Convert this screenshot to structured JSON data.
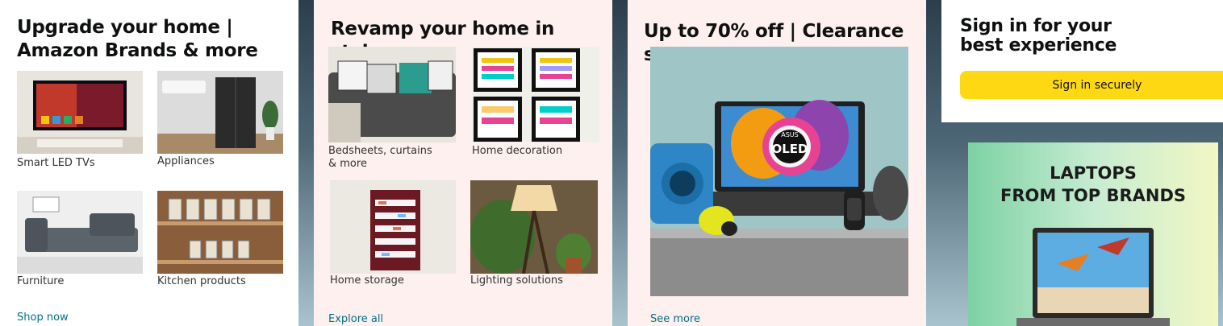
{
  "card_upgrade": {
    "title": "Upgrade your home | Amazon Brands & more",
    "tiles": [
      {
        "label": "Smart LED TVs"
      },
      {
        "label": "Appliances"
      },
      {
        "label": "Furniture"
      },
      {
        "label": "Kitchen products"
      }
    ],
    "link": "Shop now"
  },
  "card_revamp": {
    "title": "Revamp your home in style",
    "tiles": [
      {
        "label": "Bedsheets, curtains & more"
      },
      {
        "label": "Home decoration"
      },
      {
        "label": "Home storage"
      },
      {
        "label": "Lighting solutions"
      }
    ],
    "link": "Explore all"
  },
  "card_clearance": {
    "title": "Up to 70% off | Clearance store",
    "link": "See more",
    "product_badge": "OLED",
    "product_brand": "ASUS"
  },
  "signin_card": {
    "title": "Sign in for your best experience",
    "button": "Sign in securely"
  },
  "ad_banner": {
    "line1": "LAPTOPS",
    "line2": "FROM TOP BRANDS"
  },
  "colors": {
    "accent_yellow": "#ffd814",
    "link_teal": "#007185",
    "card_pink": "#fdf0ef"
  }
}
